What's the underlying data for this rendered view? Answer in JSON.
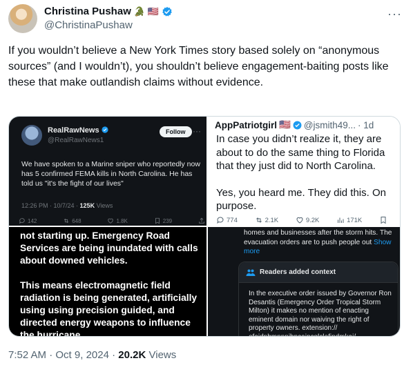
{
  "author": {
    "name": "Christina Pushaw",
    "handle": "@ChristinaPushaw",
    "name_emoji": "🐊 🇺🇸"
  },
  "tweet": {
    "text": "If you wouldn’t believe a New York Times story based solely on “anonymous sources” (and I wouldn’t), you shouldn’t believe engagement-baiting posts like these that make outlandish claims without evidence.",
    "time": "7:52 AM",
    "date": "Oct 9, 2024",
    "views": "20.2K",
    "views_label": "Views",
    "separator": "·"
  },
  "media": {
    "top_left": {
      "name": "RealRawNews",
      "handle": "@RealRawNews1",
      "follow_label": "Follow",
      "body": "We have spoken to a Marine sniper who reportedly now has 5 confirmed FEMA kills in North Carolina. He has told us \"it's the fight of our lives\"",
      "time": "12:26 PM · 10/7/24 · ",
      "views": "125K",
      "views_label": " Views",
      "replies": "142",
      "reposts": "648",
      "likes": "1.8K",
      "bookmarks": "239"
    },
    "top_right": {
      "name": "AppPatriotgirl",
      "flag": "🇺🇸",
      "handle": "@jsmith49...",
      "age": "· 1d",
      "para1": "In case you didn’t realize it, they are about to do the same thing to Florida that they just did to North Carolina.",
      "para2": "Yes, you heard me. They did this. On purpose.",
      "replies": "774",
      "reposts": "2.1K",
      "likes": "9.2K",
      "views": "171K"
    },
    "bottom_left": {
      "para1": "not starting up. Emergency Road Services are being inundated with calls about downed vehicles.",
      "para2": "This means electromagnetic field radiation is being generated, artificially using using precision guided, and directed energy weapons to influence the hurricane"
    },
    "bottom_right": {
      "text": "homes and businesses after the storm hits. The evacuation orders are to push people out ",
      "show_more": "Show more",
      "context_title": "Readers added context",
      "context_body": "In the executive order issued by Governor Ron Desantis (Emergency Order Tropical Storm Milton) it makes no mention of enacting eminent domain nor waiving the right of property owners. extension:// efaidnbmnnnibpcajpcglclefindmkaj/"
    }
  },
  "colors": {
    "accent": "#1d9bf0",
    "muted": "#536471",
    "dark_bg": "#111418"
  }
}
